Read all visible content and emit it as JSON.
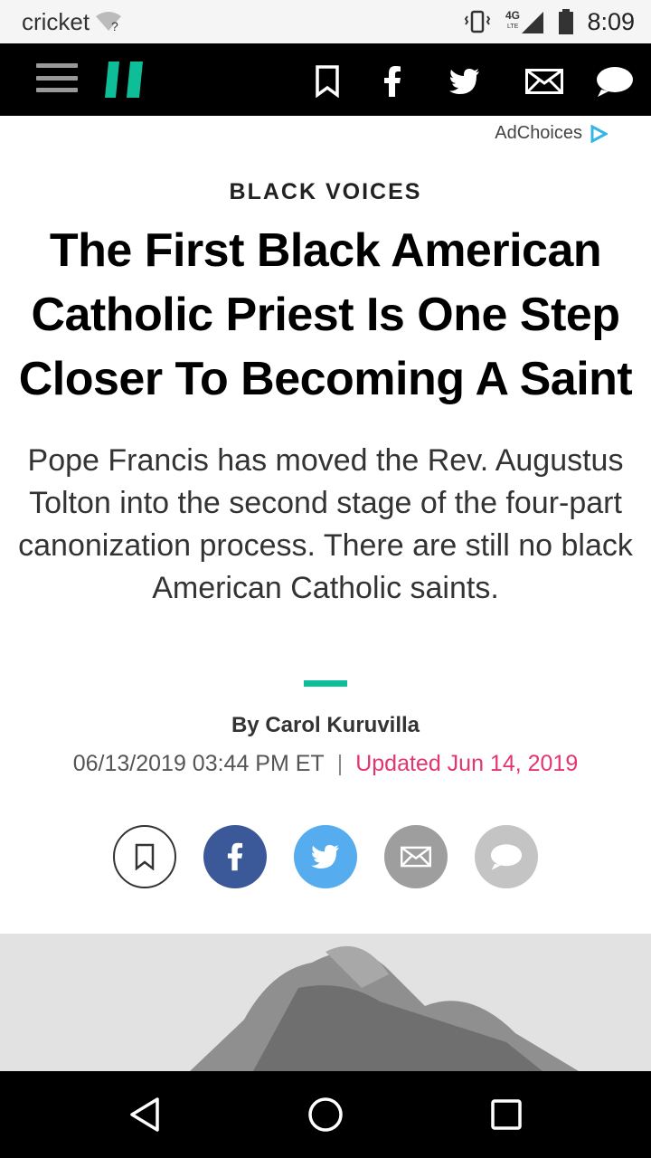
{
  "status_bar": {
    "carrier": "cricket",
    "network": "4G LTE",
    "time": "8:09",
    "icons": [
      "wifi-question-icon",
      "vibrate-icon",
      "signal-icon",
      "battery-icon"
    ]
  },
  "topnav": {
    "icons": [
      "menu-icon",
      "huffpost-logo",
      "bookmark-icon",
      "facebook-icon",
      "twitter-icon",
      "email-icon",
      "comment-icon"
    ]
  },
  "ad": {
    "label": "AdChoices"
  },
  "article": {
    "section": "BLACK VOICES",
    "headline": "The First Black American Catholic Priest Is One Step Closer To Becoming A Saint",
    "subhead": "Pope Francis has moved the Rev. Augustus Tolton into the second stage of the four-part canonization process. There are still no black American Catholic saints.",
    "byline": "By Carol Kuruvilla",
    "published": "06/13/2019 03:44 PM ET",
    "separator": "|",
    "updated": "Updated Jun 14, 2019"
  },
  "share": {
    "buttons": [
      {
        "name": "bookmark",
        "color": "#ffffff"
      },
      {
        "name": "facebook",
        "color": "#3b5998"
      },
      {
        "name": "twitter",
        "color": "#55acee"
      },
      {
        "name": "email",
        "color": "#9e9e9e"
      },
      {
        "name": "comment",
        "color": "#c4c4c4"
      }
    ]
  },
  "colors": {
    "accent": "#0dbe98",
    "updated": "#e33571",
    "logo": "#0dbe98"
  },
  "android_nav": {
    "icons": [
      "back-icon",
      "home-icon",
      "recents-icon"
    ]
  }
}
